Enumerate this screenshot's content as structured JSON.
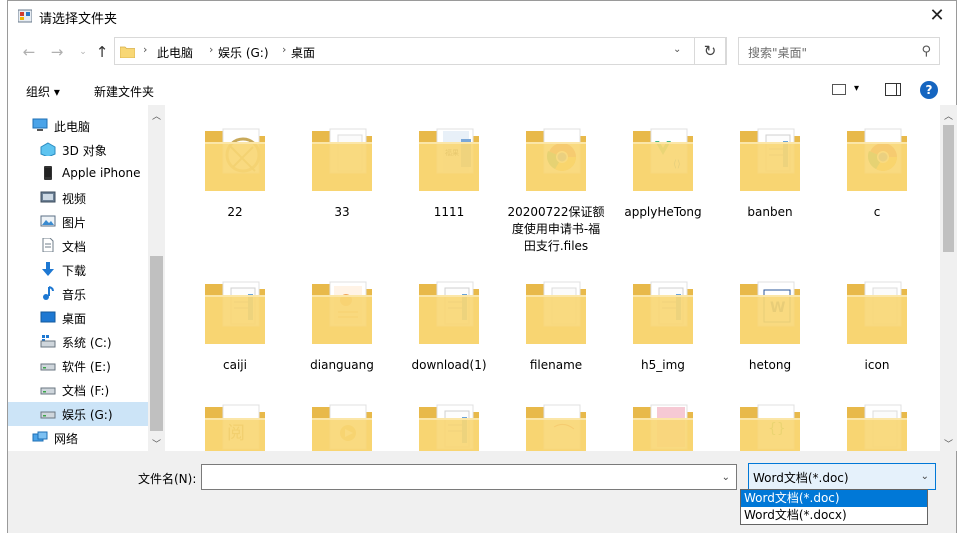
{
  "window": {
    "title": "请选择文件夹"
  },
  "address": {
    "crumbs": [
      "此电脑",
      "娱乐 (G:)",
      "桌面"
    ],
    "search_placeholder": "搜索\"桌面\""
  },
  "toolbar": {
    "organize": "组织 ▾",
    "new_folder": "新建文件夹",
    "help": "?"
  },
  "nav": {
    "items": [
      {
        "label": "此电脑",
        "icon": "computer-icon"
      },
      {
        "label": "3D 对象",
        "icon": "3d-objects-icon"
      },
      {
        "label": "Apple iPhone",
        "icon": "phone-icon"
      },
      {
        "label": "视频",
        "icon": "video-icon"
      },
      {
        "label": "图片",
        "icon": "picture-icon"
      },
      {
        "label": "文档",
        "icon": "document-icon"
      },
      {
        "label": "下载",
        "icon": "download-icon"
      },
      {
        "label": "音乐",
        "icon": "music-icon"
      },
      {
        "label": "桌面",
        "icon": "desktop-icon"
      },
      {
        "label": "系统 (C:)",
        "icon": "windows-drive-icon"
      },
      {
        "label": "软件 (E:)",
        "icon": "drive-icon"
      },
      {
        "label": "文档 (F:)",
        "icon": "drive-icon"
      },
      {
        "label": "娱乐 (G:)",
        "icon": "drive-icon",
        "selected": true
      },
      {
        "label": "网络",
        "icon": "network-icon"
      }
    ]
  },
  "files": [
    {
      "name": "22",
      "preview": "pattern"
    },
    {
      "name": "33",
      "preview": "blank"
    },
    {
      "name": "1111",
      "preview": "image"
    },
    {
      "name": "20200722保证额度使用申请书-福田支行.files",
      "preview": "chrome"
    },
    {
      "name": "applyHeTong",
      "preview": "vue"
    },
    {
      "name": "banben",
      "preview": "doc"
    },
    {
      "name": "c",
      "preview": "chrome"
    },
    {
      "name": "caiji",
      "preview": "doc"
    },
    {
      "name": "dianguang",
      "preview": "orange"
    },
    {
      "name": "download(1)",
      "preview": "doc"
    },
    {
      "name": "filename",
      "preview": "blank"
    },
    {
      "name": "h5_img",
      "preview": "doc"
    },
    {
      "name": "hetong",
      "preview": "word"
    },
    {
      "name": "icon",
      "preview": "blank"
    },
    {
      "name": "",
      "preview": "text"
    },
    {
      "name": "",
      "preview": "play"
    },
    {
      "name": "",
      "preview": "doc"
    },
    {
      "name": "",
      "preview": "red"
    },
    {
      "name": "",
      "preview": "pink"
    },
    {
      "name": "",
      "preview": "code"
    },
    {
      "name": "",
      "preview": "blank"
    }
  ],
  "bottom": {
    "filename_label": "文件名(N):",
    "filename_value": "",
    "filter_selected": "Word文档(*.doc)",
    "filter_options": [
      "Word文档(*.doc)",
      "Word文档(*.docx)"
    ]
  },
  "colors": {
    "accent": "#0078d7",
    "selection": "#cce4f7",
    "folder": "#f8d775"
  }
}
